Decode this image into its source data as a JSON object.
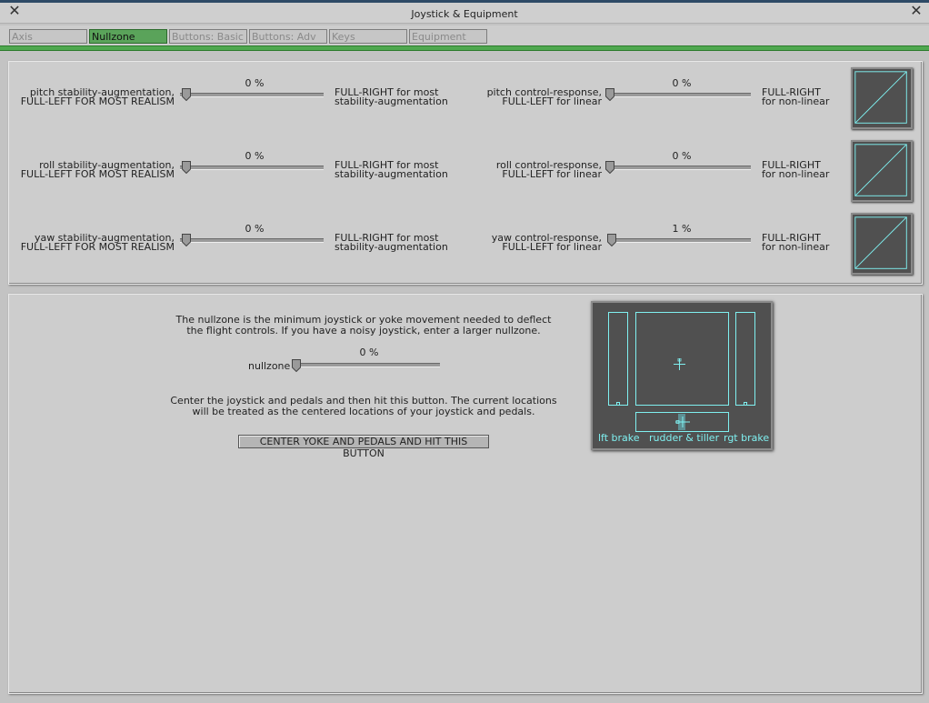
{
  "window": {
    "title": "Joystick & Equipment"
  },
  "tabs": [
    {
      "label": "Axis"
    },
    {
      "label": "Nullzone"
    },
    {
      "label": "Buttons: Basic"
    },
    {
      "label": "Buttons: Adv"
    },
    {
      "label": "Keys"
    },
    {
      "label": "Equipment"
    }
  ],
  "stability": {
    "pitch": {
      "label1": "pitch stability-augmentation,",
      "label2": "FULL-LEFT FOR MOST REALISM",
      "value": "0 %",
      "level": 0,
      "right1": "FULL-RIGHT for most",
      "right2": "stability-augmentation"
    },
    "roll": {
      "label1": "roll stability-augmentation,",
      "label2": "FULL-LEFT FOR MOST REALISM",
      "value": "0 %",
      "level": 0,
      "right1": "FULL-RIGHT for most",
      "right2": "stability-augmentation"
    },
    "yaw": {
      "label1": "yaw stability-augmentation,",
      "label2": "FULL-LEFT FOR MOST REALISM",
      "value": "0 %",
      "level": 0,
      "right1": "FULL-RIGHT for most",
      "right2": "stability-augmentation"
    }
  },
  "response": {
    "pitch": {
      "label1": "pitch control-response,",
      "label2": "FULL-LEFT for linear",
      "value": "0 %",
      "level": 0,
      "right1": "FULL-RIGHT",
      "right2": "for non-linear"
    },
    "roll": {
      "label1": "roll control-response,",
      "label2": "FULL-LEFT for linear",
      "value": "0 %",
      "level": 0,
      "right1": "FULL-RIGHT",
      "right2": "for non-linear"
    },
    "yaw": {
      "label1": "yaw control-response,",
      "label2": "FULL-LEFT for linear",
      "value": "1 %",
      "level": 0.01,
      "right1": "FULL-RIGHT",
      "right2": "for non-linear"
    }
  },
  "nullzone": {
    "info1": "The nullzone is the minimum joystick or yoke movement needed to deflect",
    "info2": "the flight controls. If you have a noisy joystick, enter a larger nullzone.",
    "label": "nullzone",
    "value": "0 %",
    "level": 0,
    "center_info1": "Center the joystick and pedals and then hit this button. The current locations",
    "center_info2": "will be treated as the centered locations of your joystick and pedals.",
    "center_button": "CENTER YOKE AND PEDALS AND HIT THIS BUTTON"
  },
  "monitor": {
    "left_brake": "lft brake",
    "rudder": "rudder & tiller",
    "right_brake": "rgt brake"
  },
  "colors": {
    "accent": "#4fa84f",
    "cyan": "#7ff0f0",
    "dark": "#505050"
  }
}
